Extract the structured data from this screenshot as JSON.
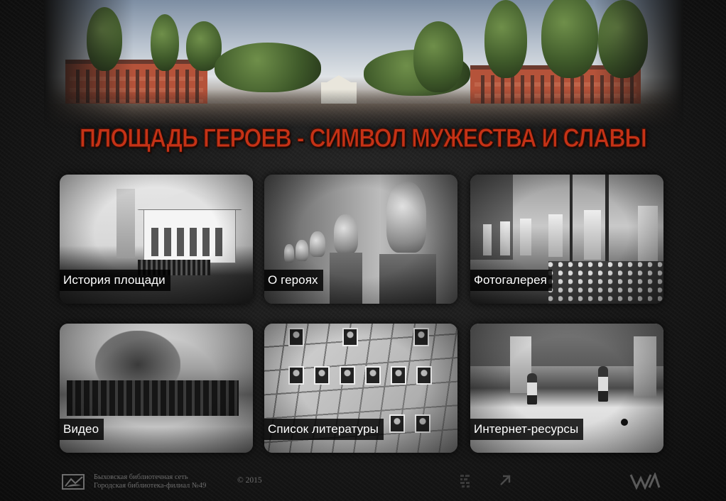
{
  "header": {
    "title": "ПЛОЩАДЬ ГЕРОЕВ - СИМВОЛ МУЖЕСТВА И СЛАВЫ"
  },
  "tiles": [
    {
      "label": "История площади",
      "icon": "photo-history-building"
    },
    {
      "label": "О героях",
      "icon": "photo-hero-busts"
    },
    {
      "label": "Фотогалерея",
      "icon": "photo-gallery-busts-alley"
    },
    {
      "label": "Видео",
      "icon": "photo-parade-ceremony"
    },
    {
      "label": "Список литературы",
      "icon": "photo-portrait-board"
    },
    {
      "label": "Интернет-ресурсы",
      "icon": "photo-children-playing"
    }
  ],
  "footer": {
    "library_line1": "Быховская библиотечная сеть",
    "library_line2": "Городская библиотека-филиал №49",
    "copyright": "© 2015"
  },
  "colors": {
    "title_red": "#c53216",
    "background": "#1a1a1a",
    "label_bg": "#000000",
    "label_text": "#ffffff",
    "footer_text": "#6d6d6d"
  }
}
